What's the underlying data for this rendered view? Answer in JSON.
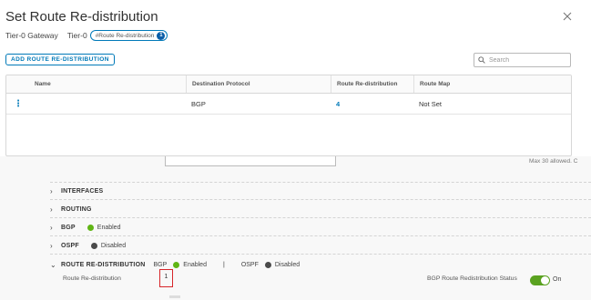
{
  "modal": {
    "title": "Set Route Re-distribution",
    "close_icon": "close-icon",
    "breadcrumb": {
      "gateway_label": "Tier-0 Gateway",
      "gateway_name": "Tier-0",
      "pill_label": "#Route Re-distribution",
      "pill_count": "1"
    },
    "add_button": "ADD ROUTE RE-DISTRIBUTION",
    "search": {
      "placeholder": "Search",
      "icon": "search-icon"
    },
    "table": {
      "headers": [
        "Name",
        "Destination Protocol",
        "Route Re-distribution",
        "Route Map"
      ],
      "rows": [
        {
          "actions_icon": "kebab-icon",
          "name": "",
          "destination_protocol": "BGP",
          "route_redistribution": "4",
          "route_map": "Not Set"
        }
      ]
    }
  },
  "lower_panel": {
    "max_note": "Max 30 allowed. C",
    "sections": {
      "interfaces": "INTERFACES",
      "routing": "ROUTING",
      "bgp": {
        "label": "BGP",
        "status": "Enabled"
      },
      "ospf": {
        "label": "OSPF",
        "status": "Disabled"
      },
      "route_redistribution": {
        "label": "ROUTE RE-DISTRIBUTION",
        "bgp_label": "BGP",
        "bgp_status": "Enabled",
        "divider": "|",
        "ospf_label": "OSPF",
        "ospf_status": "Disabled"
      }
    },
    "field": {
      "label": "Route Re-distribution",
      "value": "1"
    },
    "bgp_redistribution_status": {
      "label": "BGP Route Redistribution Status",
      "toggle": "On"
    }
  },
  "colors": {
    "accent": "#0079b8",
    "enabled": "#60b515",
    "disabled": "#4a4a4a",
    "highlight": "#d7262a"
  }
}
